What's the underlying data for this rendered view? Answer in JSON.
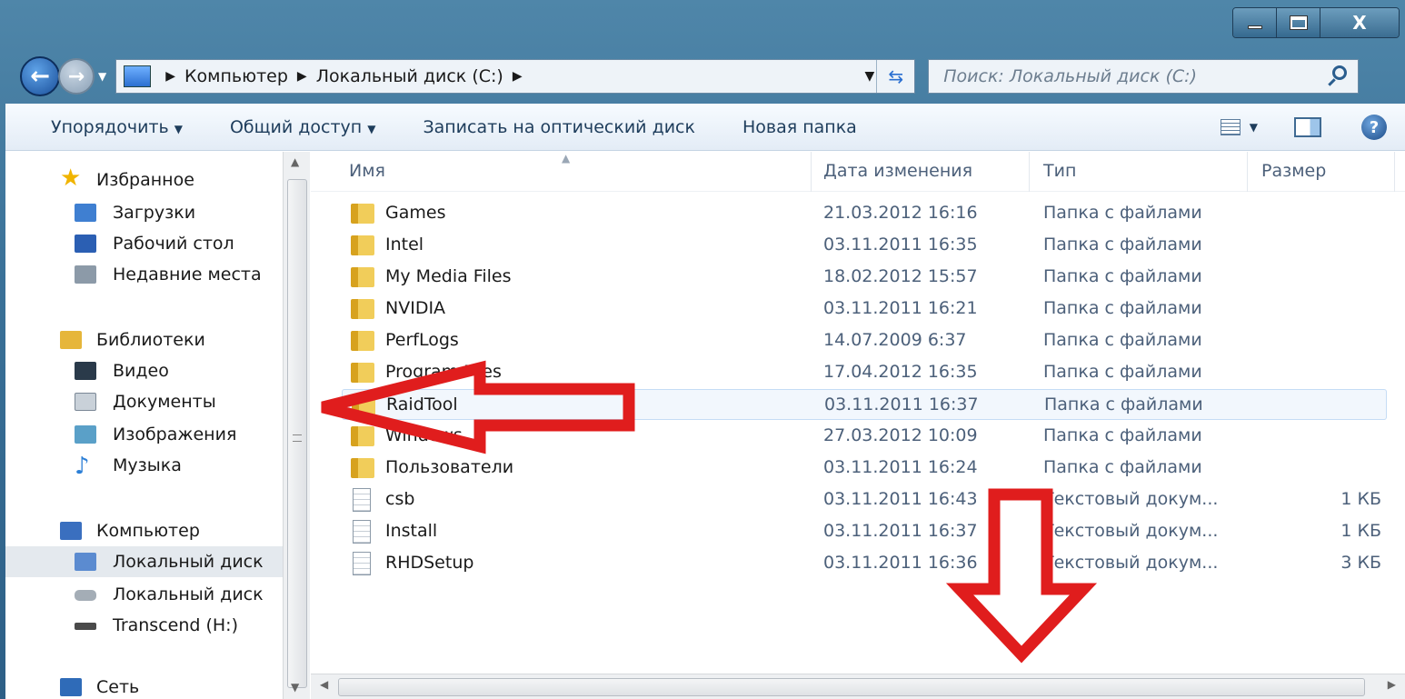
{
  "window": {
    "controls": {
      "minimize": "—",
      "maximize": "□",
      "close": "X"
    }
  },
  "address": {
    "crumbs": [
      "Компьютер",
      "Локальный диск (C:)"
    ],
    "search_placeholder": "Поиск: Локальный диск (C:)"
  },
  "toolbar": {
    "organize": "Упорядочить",
    "share": "Общий доступ",
    "burn": "Записать на оптический диск",
    "new_folder": "Новая папка"
  },
  "navpane": {
    "favorites": {
      "label": "Избранное",
      "items": [
        "Загрузки",
        "Рабочий стол",
        "Недавние места"
      ]
    },
    "libraries": {
      "label": "Библиотеки",
      "items": [
        "Видео",
        "Документы",
        "Изображения",
        "Музыка"
      ]
    },
    "computer": {
      "label": "Компьютер",
      "items": [
        "Локальный диск",
        "Локальный диск",
        "Transcend (H:)"
      ]
    },
    "network": {
      "label": "Сеть"
    }
  },
  "columns": {
    "name": "Имя",
    "date": "Дата изменения",
    "type": "Тип",
    "size": "Размер"
  },
  "files": [
    {
      "name": "Games",
      "date": "21.03.2012 16:16",
      "type": "Папка с файлами",
      "size": "",
      "kind": "folder"
    },
    {
      "name": "Intel",
      "date": "03.11.2011 16:35",
      "type": "Папка с файлами",
      "size": "",
      "kind": "folder"
    },
    {
      "name": "My Media Files",
      "date": "18.02.2012 15:57",
      "type": "Папка с файлами",
      "size": "",
      "kind": "folder"
    },
    {
      "name": "NVIDIA",
      "date": "03.11.2011 16:21",
      "type": "Папка с файлами",
      "size": "",
      "kind": "folder"
    },
    {
      "name": "PerfLogs",
      "date": "14.07.2009 6:37",
      "type": "Папка с файлами",
      "size": "",
      "kind": "folder"
    },
    {
      "name": "Program Files",
      "date": "17.04.2012 16:35",
      "type": "Папка с файлами",
      "size": "",
      "kind": "folder"
    },
    {
      "name": "RaidTool",
      "date": "03.11.2011 16:37",
      "type": "Папка с файлами",
      "size": "",
      "kind": "folder"
    },
    {
      "name": "Windows",
      "date": "27.03.2012 10:09",
      "type": "Папка с файлами",
      "size": "",
      "kind": "folder"
    },
    {
      "name": "Пользователи",
      "date": "03.11.2011 16:24",
      "type": "Папка с файлами",
      "size": "",
      "kind": "folder"
    },
    {
      "name": "csb",
      "date": "03.11.2011 16:43",
      "type": "Текстовый докум...",
      "size": "1 КБ",
      "kind": "doc"
    },
    {
      "name": "Install",
      "date": "03.11.2011 16:37",
      "type": "Текстовый докум...",
      "size": "1 КБ",
      "kind": "doc"
    },
    {
      "name": "RHDSetup",
      "date": "03.11.2011 16:36",
      "type": "Текстовый докум...",
      "size": "3 КБ",
      "kind": "doc"
    }
  ],
  "highlighted_file": "RaidTool",
  "colors": {
    "annotation_red": "#e01d1d",
    "folder": "#e9b732",
    "selection": "#c5dcf5"
  }
}
